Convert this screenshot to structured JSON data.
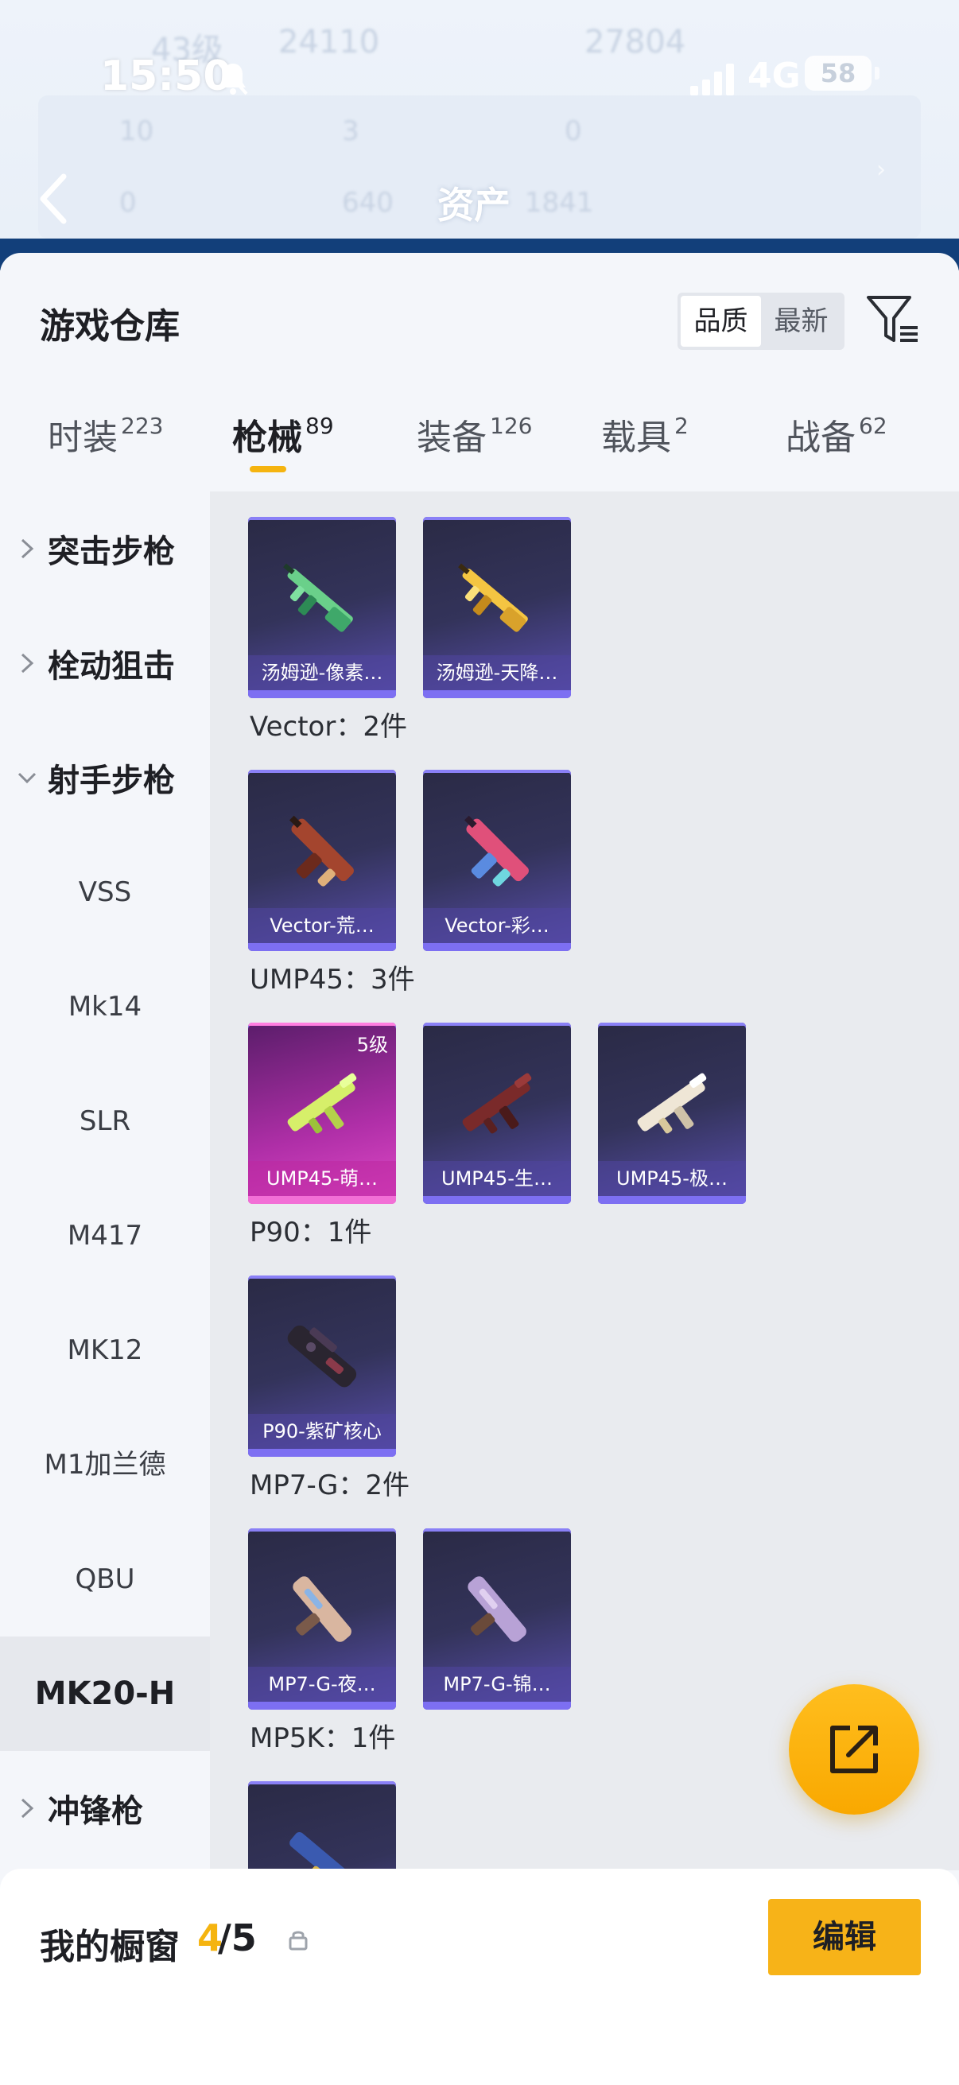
{
  "status_bar": {
    "time": "15:50",
    "network": "4G",
    "battery": "58"
  },
  "background_ghost": {
    "level": "43级",
    "coins": "24110",
    "score": "27804",
    "stats": [
      "10",
      "3",
      "0",
      "0",
      "640",
      "1841"
    ]
  },
  "header": {
    "title": "资产"
  },
  "sheet": {
    "title": "游戏仓库",
    "sort": {
      "options": [
        "品质",
        "最新"
      ],
      "active": "品质"
    }
  },
  "tabs": [
    {
      "label": "时装",
      "count": "223"
    },
    {
      "label": "枪械",
      "count": "89",
      "active": true
    },
    {
      "label": "装备",
      "count": "126"
    },
    {
      "label": "载具",
      "count": "2"
    },
    {
      "label": "战备",
      "count": "62"
    }
  ],
  "categories": {
    "groups": [
      "突击步枪",
      "栓动狙击",
      "射手步枪",
      "冲锋枪"
    ],
    "subitems": [
      "VSS",
      "Mk14",
      "SLR",
      "M417",
      "MK12",
      "M1加兰德",
      "QBU",
      "MK20-H"
    ],
    "selected": "MK20-H"
  },
  "content": {
    "groups": [
      {
        "title": "",
        "items": [
          {
            "name": "汤姆逊-像素…"
          },
          {
            "name": "汤姆逊-天降…"
          }
        ]
      },
      {
        "title": "Vector：2件",
        "items": [
          {
            "name": "Vector-荒…"
          },
          {
            "name": "Vector-彩…"
          }
        ]
      },
      {
        "title": "UMP45：3件",
        "items": [
          {
            "name": "UMP45-萌…",
            "level": "5级"
          },
          {
            "name": "UMP45-生…"
          },
          {
            "name": "UMP45-极…"
          }
        ]
      },
      {
        "title": "P90：1件",
        "items": [
          {
            "name": "P90-紫矿核心"
          }
        ]
      },
      {
        "title": "MP7-G：2件",
        "items": [
          {
            "name": "MP7-G-夜…"
          },
          {
            "name": "MP7-G-锦…"
          }
        ]
      },
      {
        "title": "MP5K：1件",
        "items": [
          {
            "name": ""
          }
        ]
      }
    ]
  },
  "showcase": {
    "label": "我的橱窗",
    "count": "4",
    "total": "/5",
    "edit_label": "编辑"
  },
  "colors": {
    "accent": "#f5b410",
    "card_purple": "#5a4fb0",
    "card_pink": "#e04ac7"
  }
}
